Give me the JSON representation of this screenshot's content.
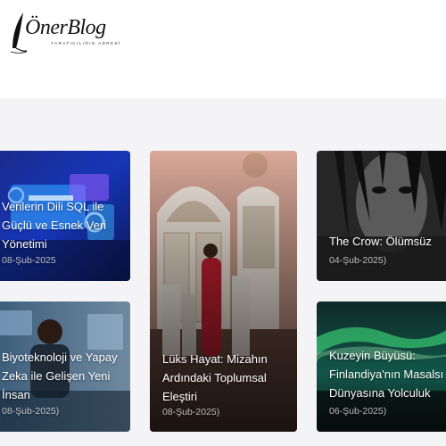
{
  "brand": {
    "name": "ÖnerBlog",
    "tagline": "YARATICILIĞIN ADRESİ"
  },
  "posts": [
    {
      "title": "Verilerin Dili SQL ile Güçlü ve Esnek Veri Yönetimi",
      "date": "08-Şub-2025"
    },
    {
      "title": "Lüks Hayat: Mizahın Ardındaki Toplumsal Eleştiri",
      "date": "08-Şub-2025)"
    },
    {
      "title": "The Crow: Ölümsüz",
      "date": "04-Şub-2025)"
    },
    {
      "title": "Biyoteknoloji ve Yapay Zeka ile Gelişen Yeni İnsan",
      "date": "08-Şub-2025)"
    },
    {
      "title": "Kuzeyin Büyüsü: Finlandiya'nın Masalsı Dünyasına Yolculuk",
      "date": "06-Şub-2025)"
    }
  ]
}
